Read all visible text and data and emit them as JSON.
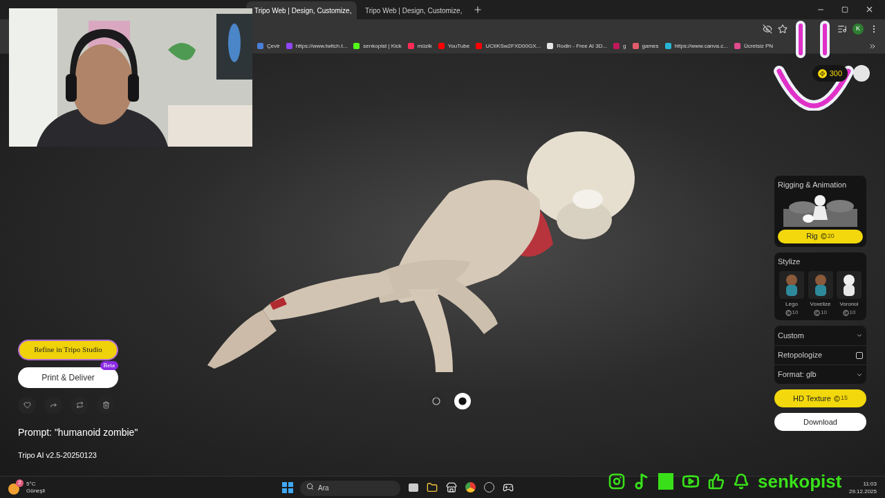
{
  "browser": {
    "tabs": [
      {
        "title": "Tripo Web | Design, Customize,",
        "selected": true
      },
      {
        "title": "Tripo Web | Design, Customize,",
        "selected": false
      }
    ],
    "bookmarks": [
      {
        "label": "Çevir",
        "color": "#4a7fd8"
      },
      {
        "label": "https://www.twitch.t...",
        "color": "#9146ff"
      },
      {
        "label": "senkopist | Kick",
        "color": "#53fc18"
      },
      {
        "label": "müzik",
        "color": "#ff2a55"
      },
      {
        "label": "YouTube",
        "color": "#ff0000"
      },
      {
        "label": "UCtIKSw2FXD00GX...",
        "color": "#ff0000"
      },
      {
        "label": "Rodin - Free AI 3D...",
        "color": "#e5e5e5"
      },
      {
        "label": "g",
        "color": "#c2185b"
      },
      {
        "label": "games",
        "color": "#e35b6a"
      },
      {
        "label": "https://www.canva.c...",
        "color": "#26b6d4"
      },
      {
        "label": "Ücretsiz PN",
        "color": "#e14a8c"
      }
    ],
    "profile_initial": "K"
  },
  "header": {
    "credits": "300"
  },
  "left": {
    "refine": "Refine in Tripo Studio",
    "print": {
      "label": "Print & Deliver",
      "badge": "Beta"
    },
    "prompt": "Prompt: \"humanoid zombie\"",
    "model": "Tripo AI v2.5-20250123"
  },
  "viewer": {
    "modes": [
      {
        "selected": false
      },
      {
        "selected": true
      }
    ]
  },
  "panel": {
    "rigging": {
      "title": "Rigging & Animation",
      "button": "Rig",
      "cost": "20"
    },
    "stylize": {
      "title": "Stylize",
      "styles": [
        {
          "label": "Lego",
          "cost": "10"
        },
        {
          "label": "Voxelize",
          "cost": "10"
        },
        {
          "label": "Voronoi",
          "cost": "10"
        }
      ]
    },
    "options": [
      {
        "kind": "dropdown",
        "label": "Custom"
      },
      {
        "kind": "checkbox",
        "label": "Retopologize",
        "checked": false
      },
      {
        "kind": "dropdown",
        "label": "Format: glb"
      }
    ],
    "hd_texture": {
      "label": "HD Texture",
      "cost": "15"
    },
    "download": "Download"
  },
  "taskbar": {
    "weather": {
      "temp": "5°C",
      "condition": "Güneşli",
      "badge": "2"
    },
    "search_placeholder": "Ara",
    "time": "11:03",
    "date": "29.12.2025"
  },
  "overlay": {
    "channel": "senkopist"
  }
}
